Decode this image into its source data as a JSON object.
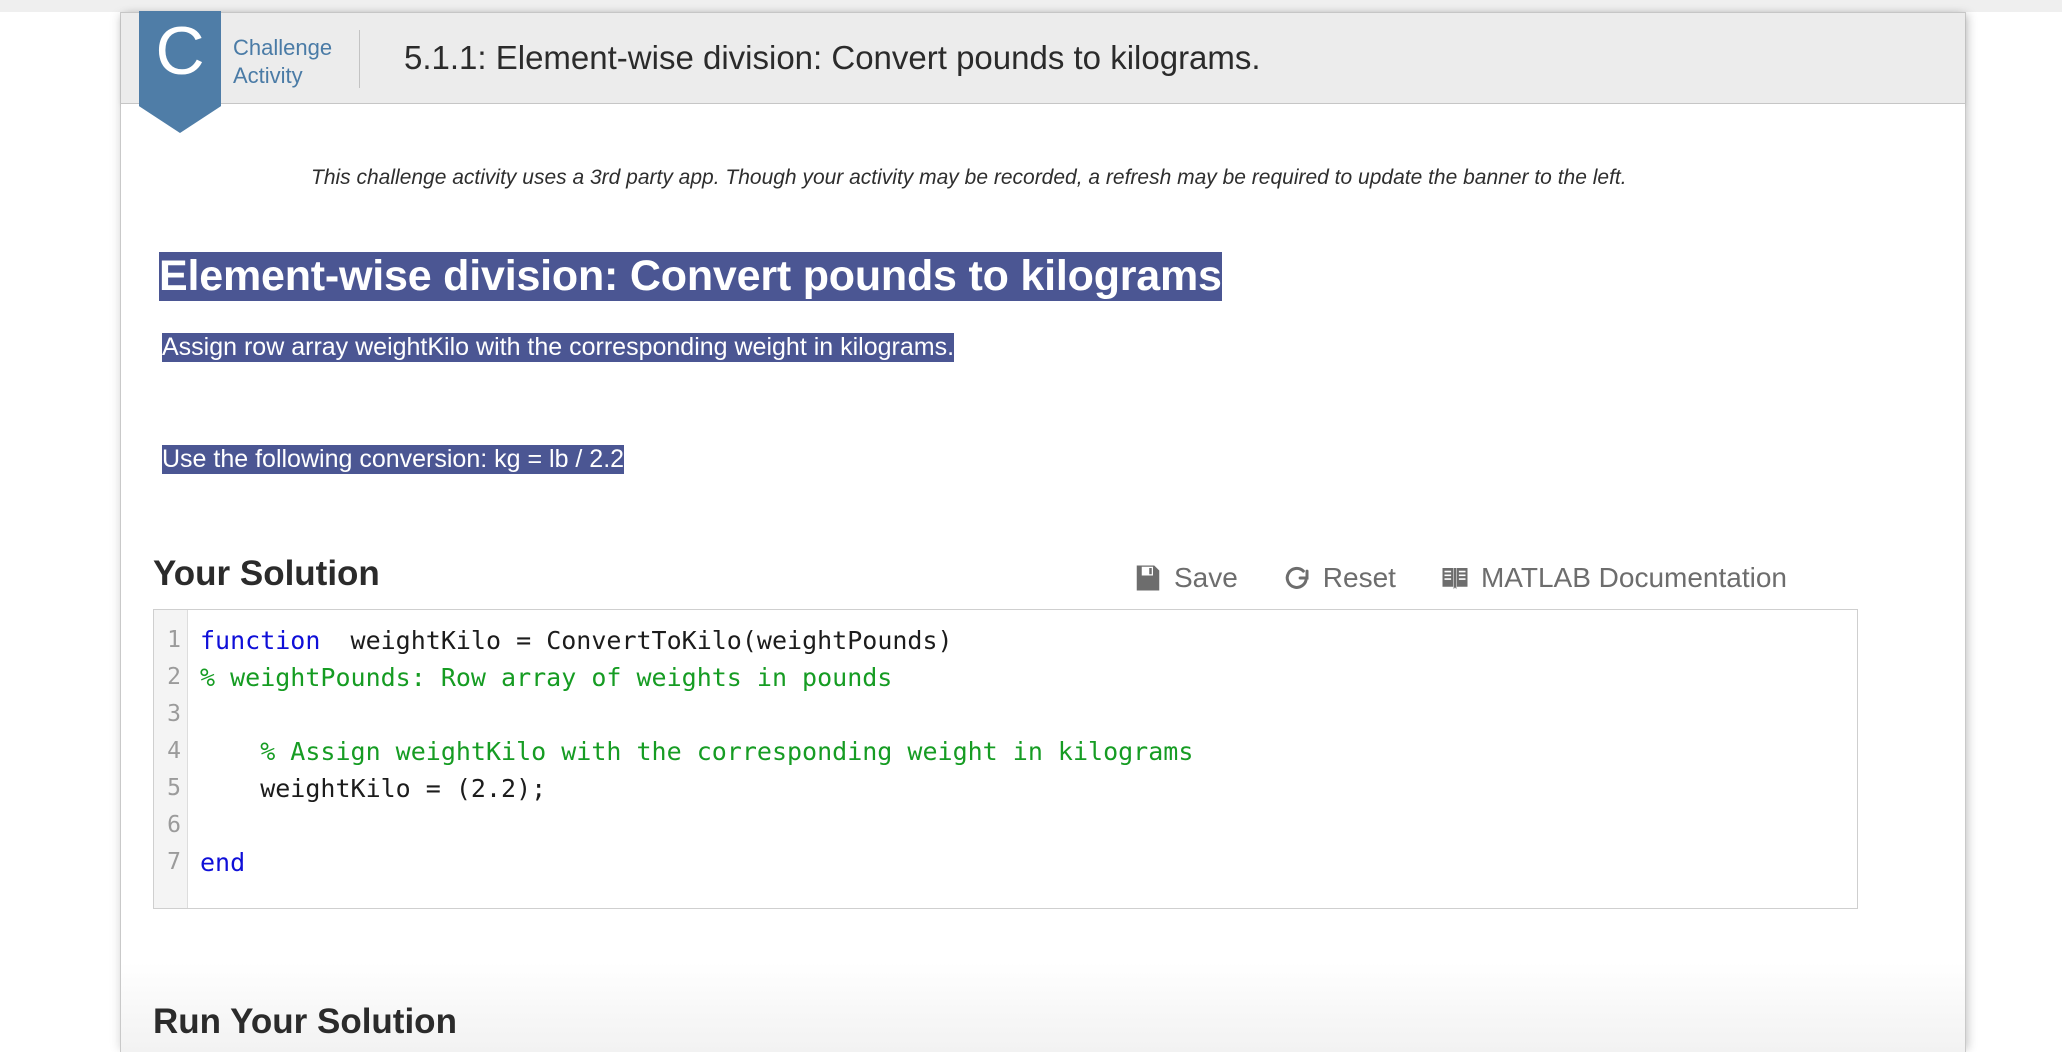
{
  "header": {
    "badge_letter": "C",
    "badge_line1": "Challenge",
    "badge_line2": "Activity",
    "title": "5.1.1: Element-wise division: Convert pounds to kilograms.",
    "shield_color": "#4f7da7",
    "badge_text_color": "#4a7ba6"
  },
  "notice": "This challenge activity uses a 3rd party app. Though your activity may be recorded, a refresh may be required to update the banner to the left.",
  "problem": {
    "title": "Element-wise division: Convert pounds to kilograms",
    "line1": "Assign row array weightKilo with the corresponding weight in kilograms.",
    "line2": "Use the following conversion: kg = lb / 2.2",
    "highlight_color": "#4b5693"
  },
  "solution": {
    "heading": "Your Solution",
    "toolbar": {
      "save_label": "Save",
      "reset_label": "Reset",
      "docs_label": "MATLAB Documentation",
      "save_icon": "floppy-disk-icon",
      "reset_icon": "circular-arrow-icon",
      "docs_icon": "open-book-icon"
    },
    "editor": {
      "line_numbers": [
        "1",
        "2",
        "3",
        "4",
        "5",
        "6",
        "7"
      ],
      "lines": [
        "function  weightKilo = ConvertToKilo(weightPounds)",
        "% weightPounds: Row array of weights in pounds",
        "",
        "    % Assign weightKilo with the corresponding weight in kilograms",
        "    weightKilo = (2.2);",
        "",
        "end"
      ],
      "keyword_color": "#0f0fd8",
      "comment_color": "#169c23"
    }
  },
  "run_section": {
    "heading": "Run Your Solution"
  }
}
